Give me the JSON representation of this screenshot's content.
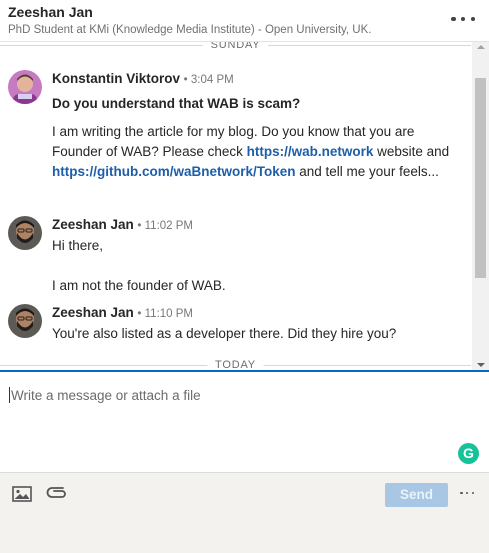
{
  "header": {
    "name": "Zeeshan Jan",
    "subtitle": "PhD Student at KMi (Knowledge Media Institute) - Open University, UK.",
    "more_icon": "more-horizontal-icon"
  },
  "dividers": {
    "sunday": "SUNDAY",
    "today": "TODAY"
  },
  "messages": [
    {
      "sender": "Konstantin Viktorov",
      "time": "• 3:04 PM",
      "subject": "Do you understand that WAB is scam?",
      "body_part1": "I am writing the article for my blog. Do you know that you are Founder of WAB? Please check ",
      "link1": "https://wab.network",
      "body_part2": " website and ",
      "link2": "https://github.com/waBnetwork/Token",
      "body_part3": " and tell me your feels..."
    },
    {
      "sender": "Zeeshan Jan",
      "time": "• 11:02 PM",
      "line1": "Hi there,",
      "line2": "I am not the founder of WAB."
    },
    {
      "sender": "Zeeshan Jan",
      "time": "• 11:10 PM",
      "line1": "You're also listed as a developer there. Did they hire you?"
    }
  ],
  "compose": {
    "placeholder": "Write a message or attach a file",
    "grammarly_icon": "grammarly-icon",
    "grammarly_letter": "G"
  },
  "footer": {
    "image_icon": "image-icon",
    "attach_icon": "paperclip-icon",
    "send_label": "Send",
    "more_icon": "more-horizontal-icon"
  },
  "colors": {
    "accent": "#0a66c2",
    "link": "#1e5ea8",
    "send_disabled": "#a8c7e4",
    "grammarly": "#15c39a"
  }
}
